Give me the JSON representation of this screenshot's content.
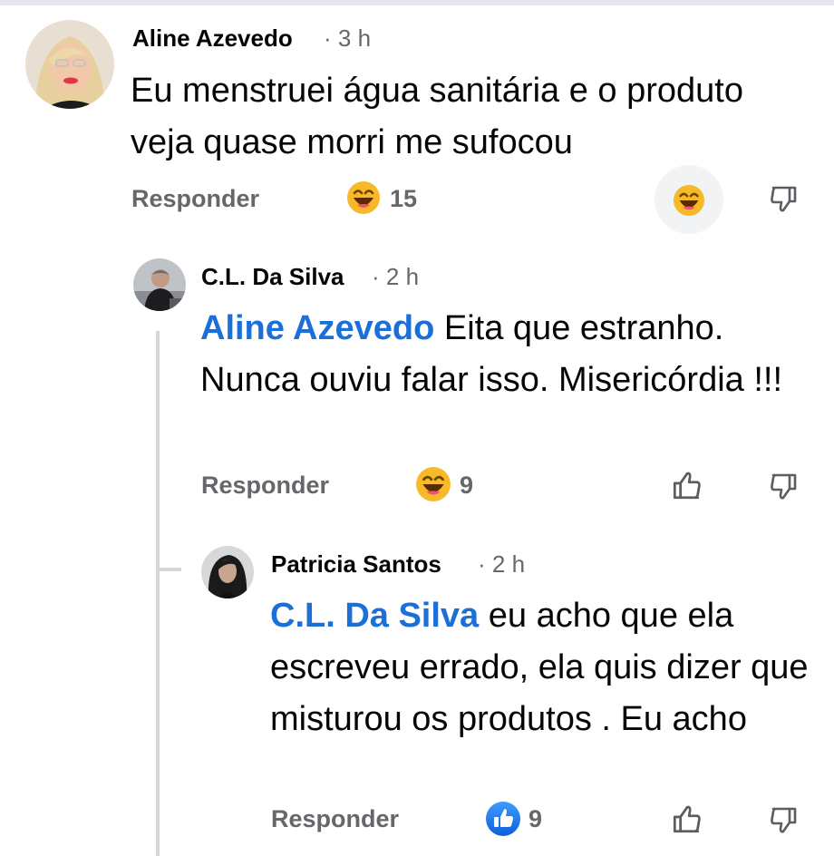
{
  "comments": [
    {
      "author": "Aline Azevedo",
      "time": "· 3 h",
      "text": "Eu menstruei água sanitária e o produto veja quase morri me sufocou",
      "reply_label": "Responder",
      "reaction_count": "15",
      "reaction_icon": "laughing-emoji-icon"
    },
    {
      "author": "C.L. Da Silva",
      "time": "· 2 h",
      "mention": "Aline Azevedo",
      "text_line1": " Eita que estranho.",
      "text_rest": "Nunca ouviu falar isso. Misericórdia  !!!",
      "reply_label": "Responder",
      "reaction_count": "9",
      "reaction_icon": "laughing-emoji-icon"
    },
    {
      "author": "Patricia Santos",
      "time": "· 2 h",
      "mention": "C.L. Da Silva",
      "text_line1": " eu acho que ela",
      "text_rest": "escreveu errado, ela  quis dizer que misturou os produtos . Eu acho",
      "reply_label": "Responder",
      "reaction_count": "9",
      "reaction_icon": "like-badge-icon"
    }
  ],
  "colors": {
    "mention": "#1b6fd8",
    "secondary_text": "#65676b",
    "emoji_yellow": "#f7b928",
    "like_blue": "#1877f2"
  }
}
